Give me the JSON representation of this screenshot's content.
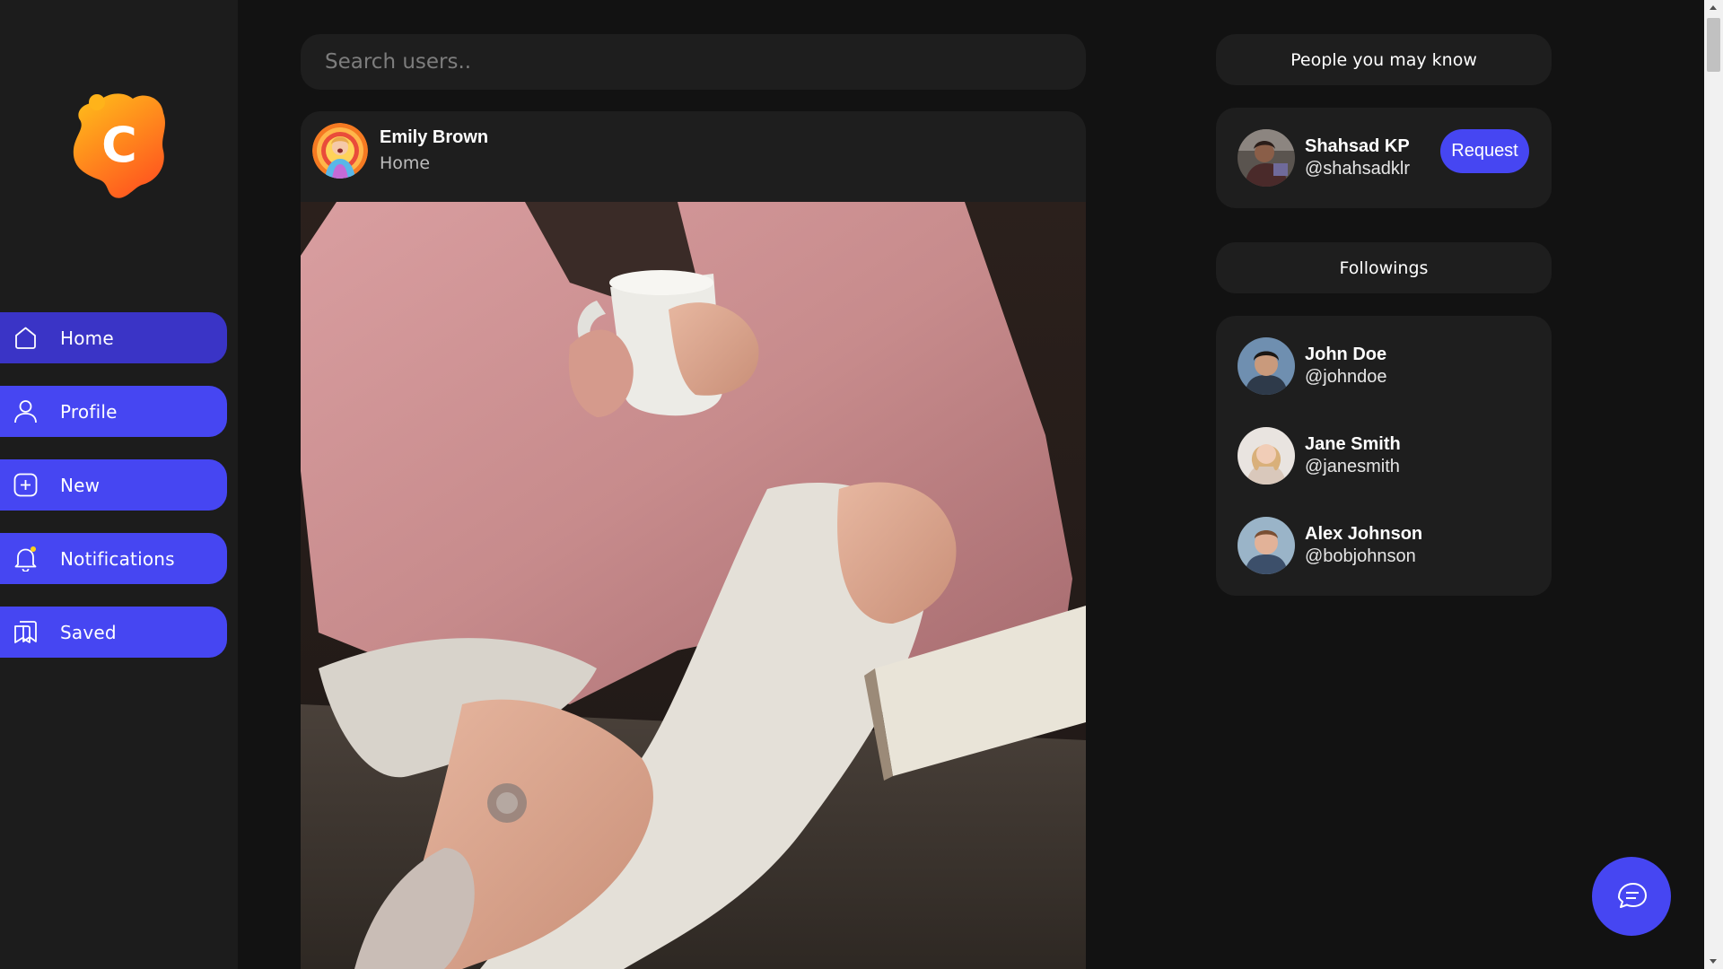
{
  "sidebar": {
    "logo_letter": "C",
    "items": [
      {
        "label": "Home",
        "icon": "home-icon",
        "active": true
      },
      {
        "label": "Profile",
        "icon": "user-icon"
      },
      {
        "label": "New",
        "icon": "plus-square-icon"
      },
      {
        "label": "Notifications",
        "icon": "bell-icon"
      },
      {
        "label": "Saved",
        "icon": "bookmark-icon"
      }
    ]
  },
  "search": {
    "placeholder": "Search users.."
  },
  "post": {
    "author": "Emily Brown",
    "location": "Home",
    "image": "woman-with-mug-on-couch"
  },
  "suggestions": {
    "title": "People you may know",
    "users": [
      {
        "name": "Shahsad KP",
        "handle": "@shahsadklr",
        "action": "Request"
      }
    ]
  },
  "followings": {
    "title": "Followings",
    "users": [
      {
        "name": "John Doe",
        "handle": "@johndoe"
      },
      {
        "name": "Jane Smith",
        "handle": "@janesmith"
      },
      {
        "name": "Alex Johnson",
        "handle": "@bobjohnson"
      }
    ]
  },
  "colors": {
    "accent": "#4646f2",
    "accent_active": "#3a34c6",
    "background": "#121212",
    "sidebar": "#1c1c1c",
    "card": "#1e1e1e"
  },
  "chat_fab": {
    "icon": "chat-bubbles-icon"
  }
}
